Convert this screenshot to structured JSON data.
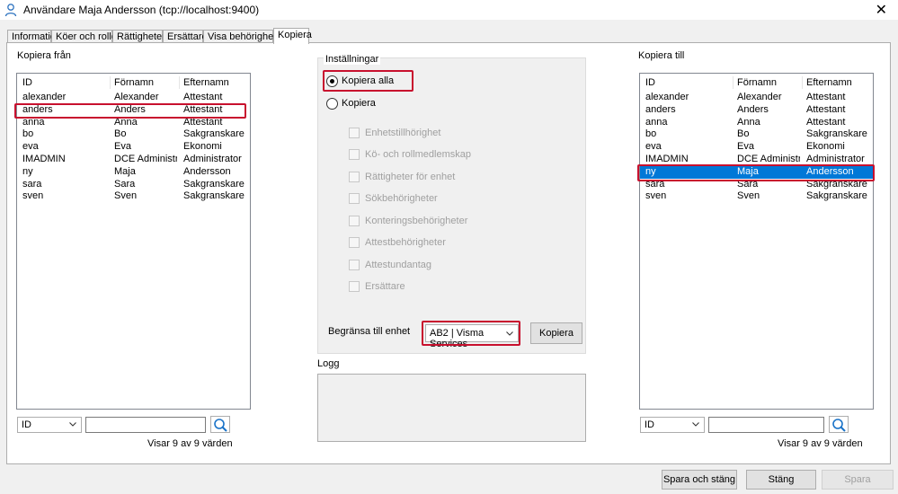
{
  "window": {
    "title": "Användare Maja Andersson (tcp://localhost:9400)",
    "close_glyph": "✕"
  },
  "tabs": [
    {
      "label": "Information"
    },
    {
      "label": "Köer och roller"
    },
    {
      "label": "Rättigheter"
    },
    {
      "label": "Ersättare"
    },
    {
      "label": "Visa behörigheter"
    },
    {
      "label": "Kopiera",
      "active": true
    }
  ],
  "copy_from": {
    "label": "Kopiera från",
    "columns": [
      "ID",
      "Förnamn",
      "Efternamn"
    ],
    "rows": [
      [
        "alexander",
        "Alexander",
        "Attestant"
      ],
      [
        "anders",
        "Anders",
        "Attestant"
      ],
      [
        "anna",
        "Anna",
        "Attestant"
      ],
      [
        "bo",
        "Bo",
        "Sakgranskare"
      ],
      [
        "eva",
        "Eva",
        "Ekonomi"
      ],
      [
        "IMADMIN",
        "DCE Administra...",
        "Administrator"
      ],
      [
        "ny",
        "Maja",
        "Andersson"
      ],
      [
        "sara",
        "Sara",
        "Sakgranskare"
      ],
      [
        "sven",
        "Sven",
        "Sakgranskare"
      ]
    ],
    "filter_field": "ID",
    "search_value": "",
    "count_text": "Visar 9 av 9 värden"
  },
  "copy_to": {
    "label": "Kopiera till",
    "columns": [
      "ID",
      "Förnamn",
      "Efternamn"
    ],
    "rows": [
      [
        "alexander",
        "Alexander",
        "Attestant"
      ],
      [
        "anders",
        "Anders",
        "Attestant"
      ],
      [
        "anna",
        "Anna",
        "Attestant"
      ],
      [
        "bo",
        "Bo",
        "Sakgranskare"
      ],
      [
        "eva",
        "Eva",
        "Ekonomi"
      ],
      [
        "IMADMIN",
        "DCE Administra...",
        "Administrator"
      ],
      [
        "ny",
        "Maja",
        "Andersson"
      ],
      [
        "sara",
        "Sara",
        "Sakgranskare"
      ],
      [
        "sven",
        "Sven",
        "Sakgranskare"
      ]
    ],
    "filter_field": "ID",
    "search_value": "",
    "count_text": "Visar 9 av 9 värden"
  },
  "settings": {
    "label": "Inställningar",
    "copy_all_label": "Kopiera alla",
    "copy_label": "Kopiera",
    "selected": "copy_all",
    "options": [
      "Enhetstillhörighet",
      "Kö- och rollmedlemskap",
      "Rättigheter för enhet",
      "Sökbehörigheter",
      "Konteringsbehörigheter",
      "Attestbehörigheter",
      "Attestundantag",
      "Ersättare"
    ],
    "limit_label": "Begränsa till enhet",
    "limit_value": "AB2 | Visma Services",
    "copy_button": "Kopiera"
  },
  "log": {
    "label": "Logg"
  },
  "footer": {
    "save_close": "Spara och stäng",
    "close": "Stäng",
    "save": "Spara"
  },
  "colors": {
    "selection": "#0078d7",
    "highlight": "#c8102e"
  }
}
